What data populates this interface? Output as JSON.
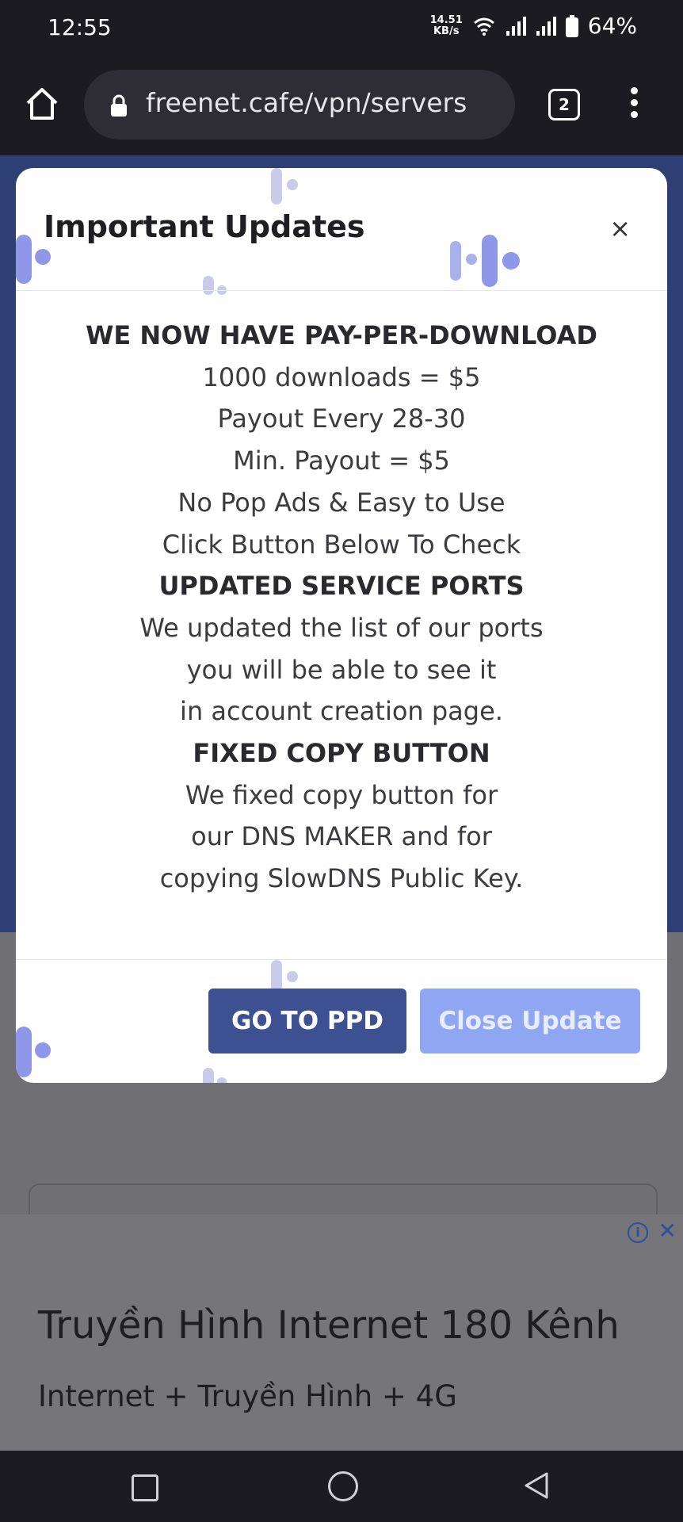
{
  "status_bar": {
    "time": "12:55",
    "net_speed_value": "14.51",
    "net_speed_unit": "KB/s",
    "battery": "64%"
  },
  "browser": {
    "url": "freenet.cafe/vpn/servers",
    "tab_count": "2"
  },
  "modal": {
    "title": "Important Updates",
    "close_symbol": "×",
    "lines": [
      {
        "text": "WE NOW HAVE PAY-PER-DOWNLOAD",
        "bold": true
      },
      {
        "text": "1000 downloads = $5",
        "bold": false
      },
      {
        "text": "Payout Every 28-30",
        "bold": false
      },
      {
        "text": "Min. Payout = $5",
        "bold": false
      },
      {
        "text": "No Pop Ads & Easy to Use",
        "bold": false
      },
      {
        "text": "Click Button Below To Check",
        "bold": false
      },
      {
        "text": "UPDATED SERVICE PORTS",
        "bold": true
      },
      {
        "text": "We updated the list of our ports",
        "bold": false
      },
      {
        "text": "you will be able to see it",
        "bold": false
      },
      {
        "text": "in account creation page.",
        "bold": false
      },
      {
        "text": "FIXED COPY BUTTON",
        "bold": true
      },
      {
        "text": "We fixed copy button for",
        "bold": false
      },
      {
        "text": "our DNS MAKER and for",
        "bold": false
      },
      {
        "text": "copying SlowDNS Public Key.",
        "bold": false
      }
    ],
    "primary_button": "GO TO PPD",
    "secondary_button": "Close Update"
  },
  "ad": {
    "title": "Truyền Hình Internet 180 Kênh",
    "subtitle": "Internet + Truyền Hình + 4G",
    "close_symbol": "✕",
    "info_symbol": "i"
  },
  "colors": {
    "primary_button": "#3d5192",
    "secondary_button": "#8fa6f2",
    "hero_background": "#2d3f73"
  }
}
